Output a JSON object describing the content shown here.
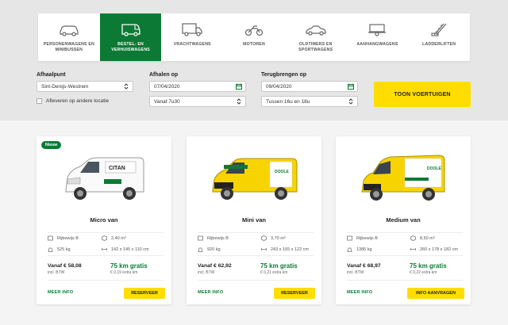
{
  "categories": [
    {
      "label": "PERSONENWAGENS EN MINIBUSSEN",
      "icon": "car-icon",
      "active": false
    },
    {
      "label": "BESTEL- EN VERHUISWAGENS",
      "icon": "van-icon",
      "active": true
    },
    {
      "label": "VRACHTWAGENS",
      "icon": "truck-icon",
      "active": false
    },
    {
      "label": "MOTOREN",
      "icon": "motorcycle-icon",
      "active": false
    },
    {
      "label": "OLDTIMERS EN SPORTWAGENS",
      "icon": "oldtimer-icon",
      "active": false
    },
    {
      "label": "AANHANGWAGENS",
      "icon": "trailer-icon",
      "active": false
    },
    {
      "label": "LADDERLIFTEN",
      "icon": "ladderlift-icon",
      "active": false
    }
  ],
  "form": {
    "pickup_label": "Afhaalpunt",
    "pickup_value": "Sint-Denijs-Westrem",
    "dropoff_other": "Afleveren op andere locatie",
    "pickup_date_label": "Afhalen op",
    "pickup_date": "07/04/2020",
    "pickup_time": "Vanaf 7u30",
    "return_label": "Terugbrengen op",
    "return_date": "09/04/2020",
    "return_time": "Tussen 16u en 18u",
    "search_button": "TOON VOERTUIGEN"
  },
  "cards": [
    {
      "badge": "Nieuw",
      "title": "Micro van",
      "license": "Rijbewijs B",
      "volume": "2,40 m³",
      "weight": "525 kg",
      "dimensions": "142 x 145 x 110 cm",
      "price": "Vanaf € 58,08",
      "price_note": "incl. BTW",
      "km": "75 km gratis",
      "km_note": "€ 0,19 extra km",
      "more": "MEER INFO",
      "cta": "RESERVEER"
    },
    {
      "badge": "",
      "title": "Mini van",
      "license": "Rijbewijs B",
      "volume": "3,70 m³",
      "weight": "920 kg",
      "dimensions": "243 x 165 x 122 cm",
      "price": "Vanaf € 62,92",
      "price_note": "incl. BTW",
      "km": "75 km gratis",
      "km_note": "€ 0,21 extra km",
      "more": "MEER INFO",
      "cta": "RESERVEER"
    },
    {
      "badge": "",
      "title": "Medium van",
      "license": "Rijbewijs B",
      "volume": "8,50 m³",
      "weight": "1385 kg",
      "dimensions": "260 x 178 x 182 cm",
      "price": "Vanaf € 68,97",
      "price_note": "incl. BTW",
      "km": "75 km gratis",
      "km_note": "€ 0,22 extra km",
      "more": "MEER INFO",
      "cta": "INFO AANVRAGEN"
    }
  ],
  "colors": {
    "brand_green": "#0c7a34",
    "accent_yellow": "#ffdd00"
  }
}
